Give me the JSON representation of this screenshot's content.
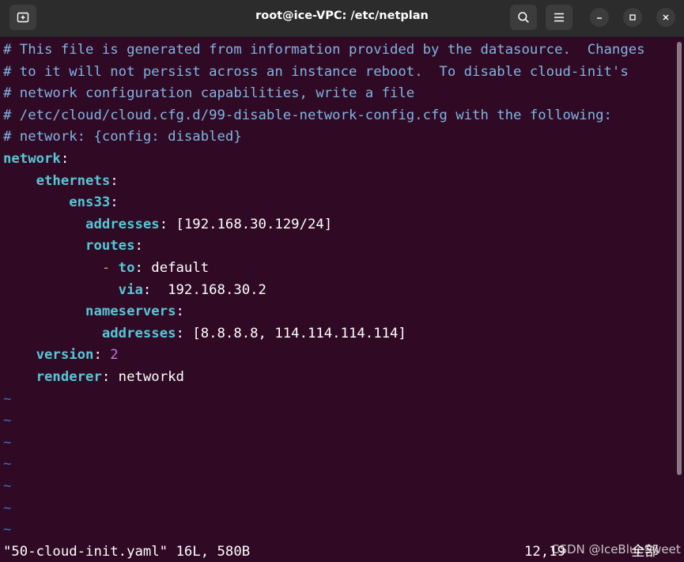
{
  "window": {
    "title": "root@ice-VPC: /etc/netplan"
  },
  "titlebar": {
    "new_tab_icon": "new-tab-icon",
    "search_icon": "search-icon",
    "menu_icon": "hamburger-menu-icon",
    "minimize_icon": "minimize-icon",
    "maximize_icon": "maximize-icon",
    "close_icon": "close-icon"
  },
  "colors": {
    "background": "#300a24",
    "titlebar": "#2c2c2c",
    "comment": "#7fb4e3",
    "key": "#56c7d6",
    "list_dash": "#e3a72f",
    "number": "#c678dd",
    "tilde": "#3d6fc4"
  },
  "editor": {
    "lines": [
      {
        "comment": "# This file is generated from information provided by the datasource.  Changes"
      },
      {
        "comment": "# to it will not persist across an instance reboot.  To disable cloud-init's"
      },
      {
        "comment": "# network configuration capabilities, write a file"
      },
      {
        "comment": "# /etc/cloud/cloud.cfg.d/99-disable-network-config.cfg with the following:"
      },
      {
        "comment": "# network: {config: disabled}"
      },
      {
        "key": "network",
        "sep": ":"
      },
      {
        "indent": "    ",
        "key": "ethernets",
        "sep": ":"
      },
      {
        "indent": "        ",
        "key": "ens33",
        "sep": ":"
      },
      {
        "indent": "          ",
        "key": "addresses",
        "sep": ": ",
        "value": "[192.168.30.129/24]"
      },
      {
        "indent": "          ",
        "key": "routes",
        "sep": ":"
      },
      {
        "indent": "            ",
        "dash": "- ",
        "key": "to",
        "sep": ": ",
        "value": "default"
      },
      {
        "indent": "              ",
        "key": "via",
        "sep": ":  ",
        "value": "192.168.30.2"
      },
      {
        "indent": "          ",
        "key": "nameservers",
        "sep": ":"
      },
      {
        "indent": "            ",
        "key": "addresses",
        "sep": ": ",
        "value": "[8.8.8.8, 114.114.114.114]"
      },
      {
        "indent": "    ",
        "key": "version",
        "sep": ": ",
        "number": "2"
      },
      {
        "indent": "    ",
        "key": "renderer",
        "sep": ": ",
        "value": "networkd"
      }
    ],
    "tildes": [
      "~",
      "~",
      "~",
      "~",
      "~",
      "~",
      "~"
    ]
  },
  "statusbar": {
    "file_info": "\"50-cloud-init.yaml\" 16L, 580B",
    "cursor_pos": "12,19",
    "scroll_pos": "全部"
  },
  "watermark": "CSDN @IceBlueSweet"
}
